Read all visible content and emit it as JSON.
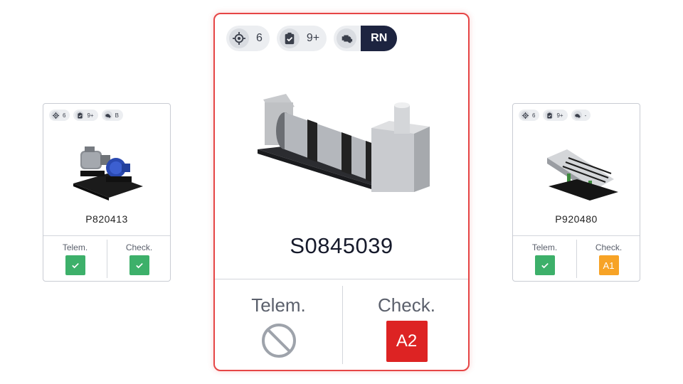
{
  "cards": {
    "left": {
      "chips": {
        "targets": "6",
        "checks": "9+",
        "engine": "B"
      },
      "code": "P820413",
      "telemetry": {
        "label": "Telem.",
        "status": "ok"
      },
      "check": {
        "label": "Check.",
        "status": "ok"
      }
    },
    "center": {
      "chips": {
        "targets": "6",
        "checks": "9+",
        "engine": "RN"
      },
      "code": "S0845039",
      "telemetry": {
        "label": "Telem.",
        "status": "none"
      },
      "check": {
        "label": "Check.",
        "grade": "A2"
      }
    },
    "right": {
      "chips": {
        "targets": "6",
        "checks": "9+",
        "engine": "-"
      },
      "code": "P920480",
      "telemetry": {
        "label": "Telem.",
        "status": "ok"
      },
      "check": {
        "label": "Check.",
        "grade": "A1"
      }
    }
  },
  "colors": {
    "selected_border": "#e64545",
    "ok_green": "#3db06a",
    "grade_red": "#dd2323",
    "grade_amber": "#f7a326",
    "engine_dark": "#1d2440"
  },
  "icons": [
    "crosshair-icon",
    "clipboard-check-icon",
    "engine-icon",
    "check-icon",
    "no-entry-icon"
  ]
}
